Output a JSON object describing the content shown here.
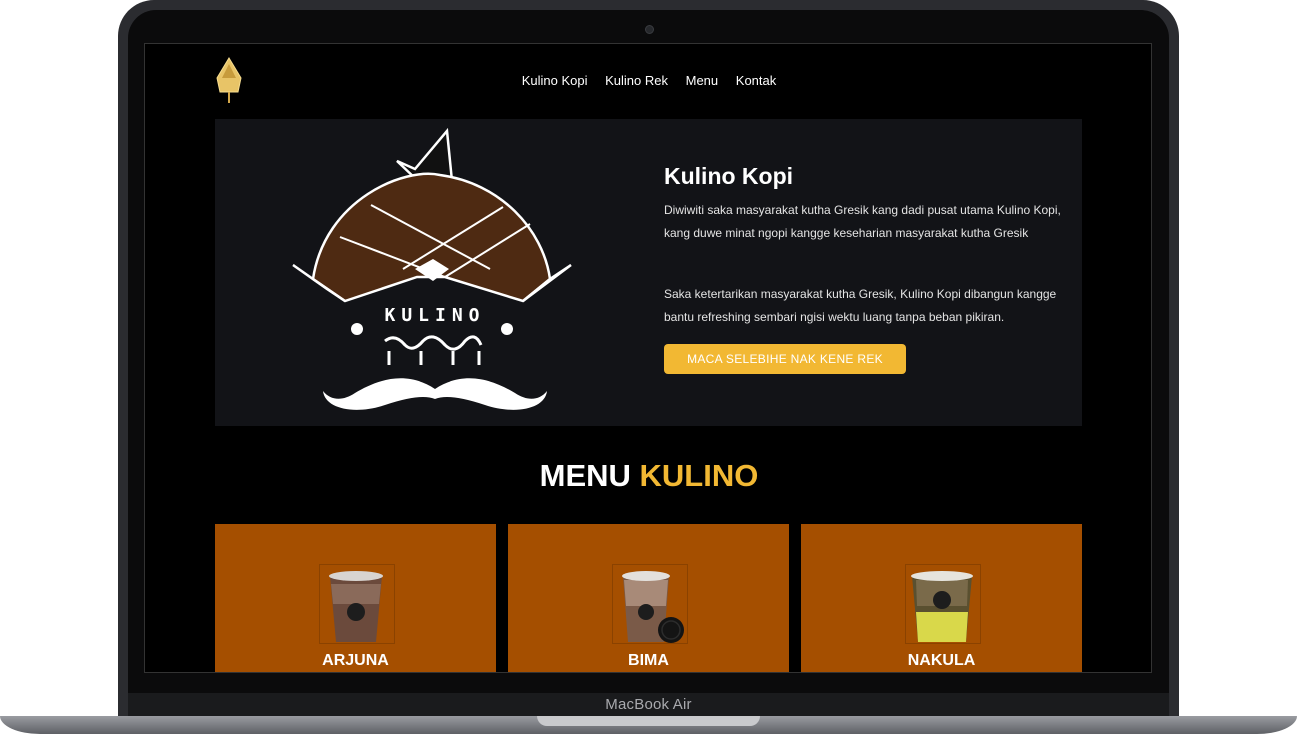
{
  "device": {
    "label": "MacBook Air"
  },
  "nav": {
    "items": [
      "Kulino Kopi",
      "Kulino Rek",
      "Menu",
      "Kontak"
    ]
  },
  "hero": {
    "title": "Kulino Kopi",
    "paragraph1": "Diwiwiti saka masyarakat kutha Gresik kang dadi pusat utama Kulino Kopi, kang duwe minat ngopi kangge keseharian masyarakat kutha Gresik",
    "paragraph2": "Saka ketertarikan masyarakat kutha Gresik, Kulino Kopi dibangun kangge bantu refreshing sembari ngisi wektu luang tanpa beban pikiran.",
    "button_label": "MACA SELEBIHE NAK KENE REK",
    "logo_text": "KULINO"
  },
  "menu_section": {
    "heading_part1": "MENU",
    "heading_part2": "KULINO",
    "items": [
      {
        "name": "ARJUNA"
      },
      {
        "name": "BIMA"
      },
      {
        "name": "NAKULA"
      }
    ]
  },
  "colors": {
    "accent": "#f2b833",
    "card": "#a54f00",
    "hero_bg": "#121317",
    "page_bg": "#000000"
  }
}
